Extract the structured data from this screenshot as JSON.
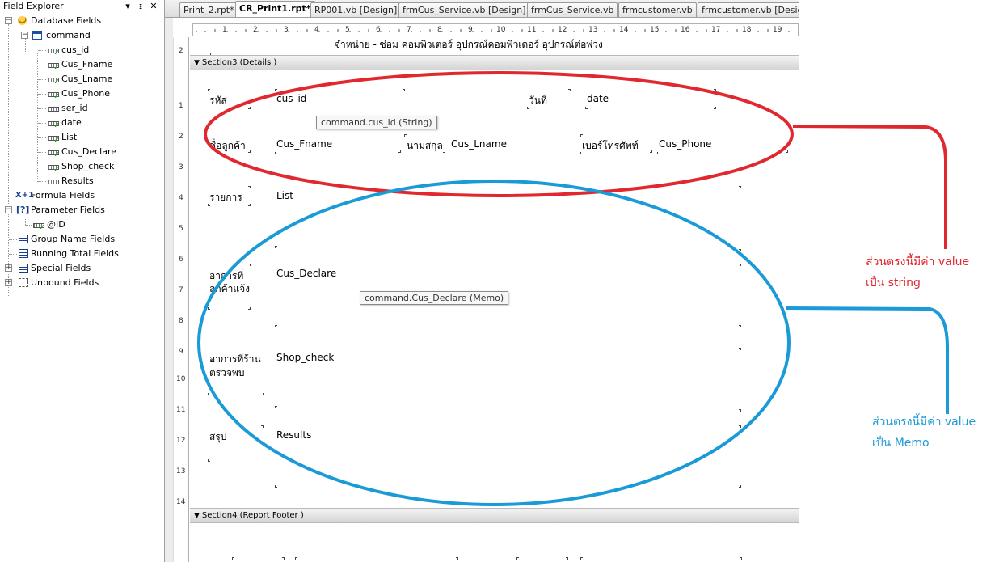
{
  "explorer": {
    "title": "Field Explorer",
    "pin_glyph": "▾",
    "dock_glyph": "ᵻ",
    "close_glyph": "✕",
    "tree": {
      "database_fields": "Database Fields",
      "command": "command",
      "fields": [
        "cus_id",
        "Cus_Fname",
        "Cus_Lname",
        "Cus_Phone",
        "ser_id",
        "date",
        "List",
        "Cus_Declare",
        "Shop_check",
        "Results"
      ],
      "formula_fields": "Formula Fields",
      "parameter_fields": "Parameter Fields",
      "parameter_id": "@ID",
      "group_name_fields": "Group Name Fields",
      "running_total_fields": "Running Total Fields",
      "special_fields": "Special Fields",
      "unbound_fields": "Unbound Fields",
      "formula_icon": "X+1",
      "param_icon": "[?]"
    }
  },
  "tabs": [
    {
      "label": "Print_2.rpt*"
    },
    {
      "label": "CR_Print1.rpt*"
    },
    {
      "label": "RP001.vb [Design]"
    },
    {
      "label": "frmCus_Service.vb [Design]"
    },
    {
      "label": "frmCus_Service.vb"
    },
    {
      "label": "frmcustomer.vb"
    },
    {
      "label": "frmcustomer.vb [Design]"
    }
  ],
  "ruler": {
    "marks": [
      "1",
      "2",
      "3",
      "4",
      "5",
      "6",
      "7",
      "8",
      "9",
      "10",
      "11",
      "12",
      "13",
      "14",
      "15",
      "16",
      "17",
      "18",
      "19"
    ],
    "left_marks": [
      "2",
      "1",
      "2",
      "3",
      "4",
      "5",
      "6",
      "7",
      "8",
      "9",
      "10",
      "11",
      "12",
      "13",
      "14"
    ]
  },
  "report": {
    "header_text": "จำหน่าย - ซ่อม คอมพิวเตอร์ อุปกรณ์คอมพิวเตอร์ อุปกรณ์ต่อพ่วง",
    "section3": "Section3 (Details  )",
    "section4": "Section4 (Report Footer  )",
    "labels": {
      "code": "รหัส",
      "date": "วันที่",
      "customer": "ชื่อลูกค้า",
      "surname": "นามสกุล",
      "phone": "เบอร์โทรศัพท์",
      "list": "รายการ",
      "symptom_customer_1": "อาการที่",
      "symptom_customer_2": "ลูกค้าแจ้ง",
      "symptom_shop_1": "อาการที่ร้าน",
      "symptom_shop_2": "ตรวจพบ",
      "summary": "สรุป"
    },
    "fields": {
      "cus_id": "cus_id",
      "date": "date",
      "cus_fname": "Cus_Fname",
      "cus_lname": "Cus_Lname",
      "cus_phone": "Cus_Phone",
      "list": "List",
      "cus_declare": "Cus_Declare",
      "shop_check": "Shop_check",
      "results": "Results"
    },
    "tooltips": {
      "cus_id": "command.cus_id (String)",
      "cus_declare": "command.Cus_Declare (Memo)"
    },
    "section_triangle": "▼"
  },
  "annotations": {
    "red_line1": "ส่วนตรงนี้มีค่า value",
    "red_line2": "เป็น string",
    "blue_line1": "ส่วนตรงนี้มีค่า value",
    "blue_line2": "เป็น Memo",
    "red_color": "#e0282e",
    "blue_color": "#1a9ad6"
  }
}
